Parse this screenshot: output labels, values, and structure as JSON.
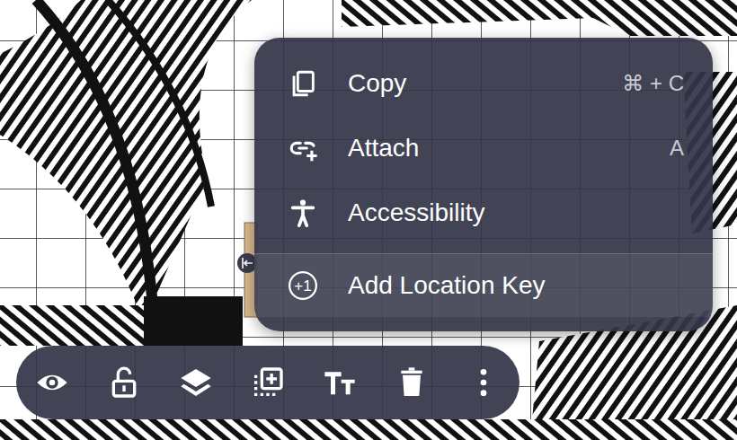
{
  "menu": {
    "items": [
      {
        "label": "Copy",
        "shortcut": "⌘ + C",
        "highlighted": false,
        "divider_above": false
      },
      {
        "label": "Attach",
        "shortcut": "A",
        "highlighted": false,
        "divider_above": false
      },
      {
        "label": "Accessibility",
        "highlighted": false,
        "divider_above": false
      },
      {
        "label": "Add Location Key",
        "badge": "+1",
        "highlighted": true,
        "divider_above": true
      }
    ]
  },
  "toolbar": {
    "visible": true,
    "locked": false
  }
}
